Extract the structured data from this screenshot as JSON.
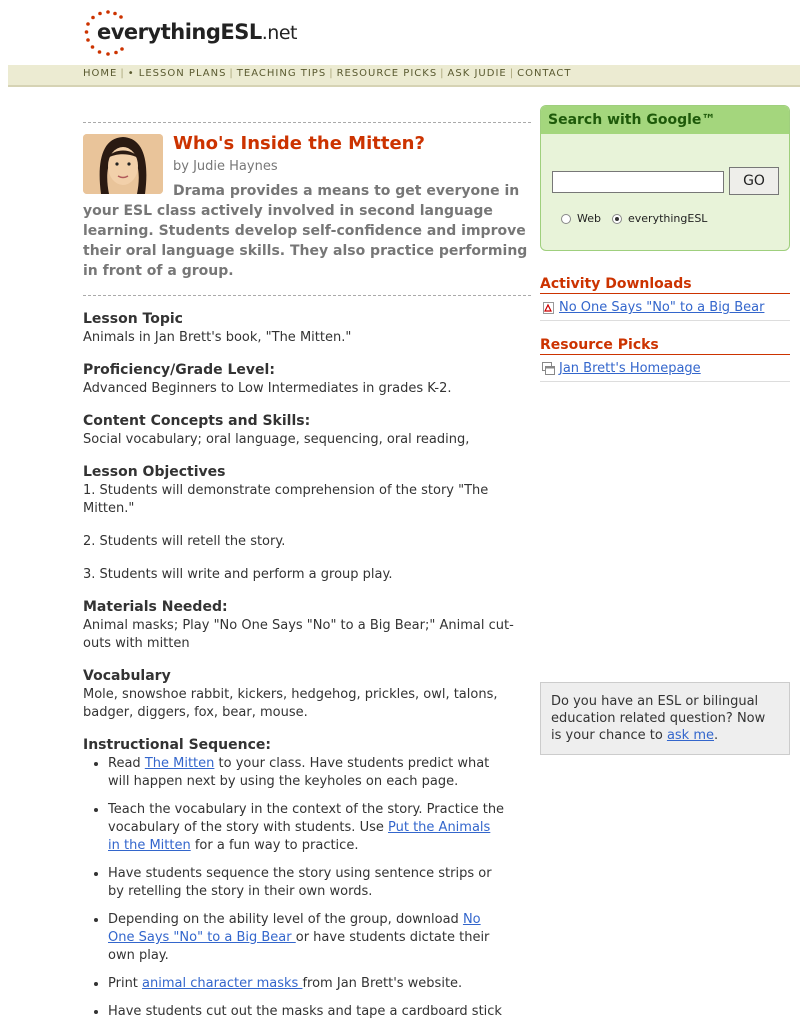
{
  "logo": {
    "name": "everythingESL",
    "tld": ".net"
  },
  "nav": [
    "HOME",
    "• LESSON PLANS",
    "TEACHING TIPS",
    "RESOURCE PICKS",
    "ASK JUDIE",
    "CONTACT"
  ],
  "article": {
    "title": "Who's Inside the Mitten?",
    "byline": "by Judie Haynes",
    "intro": "Drama provides a means to get everyone in your ESL class actively involved in second language learning. Students develop self-confidence and improve their oral language skills. They also practice performing in front of a group."
  },
  "sections": {
    "topic": {
      "heading": "Lesson Topic",
      "text": "Animals in Jan Brett's book, \"The Mitten.\""
    },
    "level": {
      "heading": "Proficiency/Grade Level:",
      "text": "Advanced Beginners to Low Intermediates in grades K-2."
    },
    "concepts": {
      "heading": "Content Concepts and Skills:",
      "text": "Social vocabulary; oral language, sequencing, oral reading,"
    },
    "objectives": {
      "heading": "Lesson Objectives",
      "items": [
        "1. Students will demonstrate comprehension of the story \"The Mitten.\"",
        "2. Students will retell the story.",
        "3. Students will write and perform a group play."
      ]
    },
    "materials": {
      "heading": "Materials Needed:",
      "text": "Animal masks; Play \"No One Says \"No\" to a Big Bear;\" Animal cut-outs with mitten"
    },
    "vocab": {
      "heading": "Vocabulary",
      "text": "Mole, snowshoe rabbit, kickers, hedgehog, prickles, owl, talons, badger, diggers, fox, bear, mouse."
    },
    "sequence": {
      "heading": "Instructional Sequence:",
      "s1": {
        "a": "Read ",
        "link": "The Mitten",
        "b": " to your class. Have students predict what will happen next by using the keyholes on each page."
      },
      "s2": {
        "a": "Teach the vocabulary in the context of the story. Practice the vocabulary of the story with students. Use ",
        "link": "Put the Animals in the Mitten",
        "b": " for a fun way to practice."
      },
      "s3": {
        "a": "Have students sequence the story using sentence strips or by retelling the story in their own words."
      },
      "s4": {
        "a": "Depending on the ability level of the group, download ",
        "link": "No One Says \"No\" to a Big Bear ",
        "b": "or have students dictate their own play."
      },
      "s5": {
        "a": "Print ",
        "link": "animal character masks ",
        "b": "from Jan Brett's website."
      },
      "s6": {
        "a": "Have students cut out the masks and tape a cardboard stick"
      }
    }
  },
  "search": {
    "title": "Search with Google™",
    "button": "GO",
    "option_web": "Web",
    "option_site": "everythingESL"
  },
  "sidebar": {
    "downloads_heading": "Activity Downloads",
    "download_link": "No One Says \"No\" to a Big Bear",
    "picks_heading": "Resource Picks",
    "pick_link": "Jan Brett's Homepage"
  },
  "ask": {
    "text": "Do you have an ESL or bilingual education related question? Now is your chance to ",
    "link": "ask me",
    "end": "."
  },
  "colors": {
    "accent": "#cc3300",
    "nav_bg": "#ecebd2",
    "google_bg": "#e8f3d9",
    "google_head": "#a4d67d",
    "link": "#3366cc"
  }
}
